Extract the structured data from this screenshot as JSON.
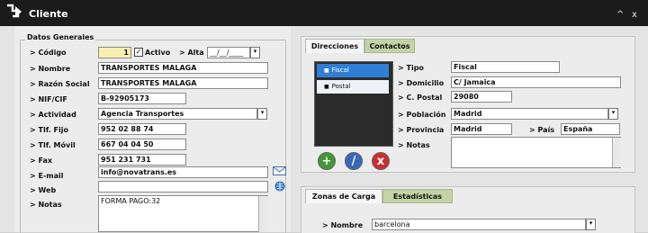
{
  "window": {
    "title": "Cliente",
    "minimize_label": "^",
    "close_label": "x"
  },
  "datos_generales": {
    "legend": "Datos Generales",
    "codigo": {
      "label": "> Código",
      "value": "1"
    },
    "activo": {
      "label": "Activo",
      "checked": true
    },
    "alta": {
      "label": "> Alta",
      "value": "__/__/____"
    },
    "nombre": {
      "label": "> Nombre",
      "value": "TRANSPORTES MALAGA"
    },
    "razon_social": {
      "label": "> Razón Social",
      "value": "TRANSPORTES MALAGA"
    },
    "nif": {
      "label": "> NIF/CIF",
      "value": "B-92905173"
    },
    "actividad": {
      "label": "> Actividad",
      "value": "Agencia Transportes"
    },
    "tlf_fijo": {
      "label": "> Tlf. Fijo",
      "value": "952 02 88 74"
    },
    "tlf_movil": {
      "label": "> Tlf. Móvil",
      "value": "667 04 04 50"
    },
    "fax": {
      "label": "> Fax",
      "value": "951 231 731"
    },
    "email": {
      "label": "> E-mail",
      "value": "info@novatrans.es"
    },
    "web": {
      "label": "> Web",
      "value": ""
    },
    "notas": {
      "label": "> Notas",
      "value": "FORMA PAGO:32"
    }
  },
  "direcciones": {
    "tabs": [
      "Direcciones",
      "Contactos"
    ],
    "active_tab": "Direcciones",
    "list": [
      "Fiscal",
      "Postal"
    ],
    "selected": "Fiscal",
    "tipo": {
      "label": "> Tipo",
      "value": "Fiscal"
    },
    "domicilio": {
      "label": "> Domicilio",
      "value": "C/ Jamaica"
    },
    "cpostal": {
      "label": "> C. Postal",
      "value": "29080"
    },
    "poblacion": {
      "label": "> Población",
      "value": "Madrid"
    },
    "provincia": {
      "label": "> Provincia",
      "value": "Madrid"
    },
    "pais": {
      "label": "> País",
      "value": "España"
    },
    "notas": {
      "label": "> Notas",
      "value": ""
    },
    "buttons": {
      "add": "+",
      "edit": "/",
      "delete": "x"
    }
  },
  "zonas": {
    "tabs": [
      "Zonas de Carga",
      "Estadísticas"
    ],
    "active_tab": "Zonas de Carga",
    "nombre": {
      "label": "> Nombre",
      "value": "barcelona"
    }
  },
  "icons": {
    "dropdown_arrow": "▾",
    "mail": "mail-icon",
    "web": "web-icon"
  },
  "colors": {
    "titlebar": "#1b1b1b",
    "list_selected": "#2f7fd6",
    "tab_inactive": "#c3d3a5",
    "add_button": "#3f9a34",
    "edit_button": "#3769b7",
    "delete_button": "#c92f2f",
    "required_field": "#f7f0b0"
  }
}
